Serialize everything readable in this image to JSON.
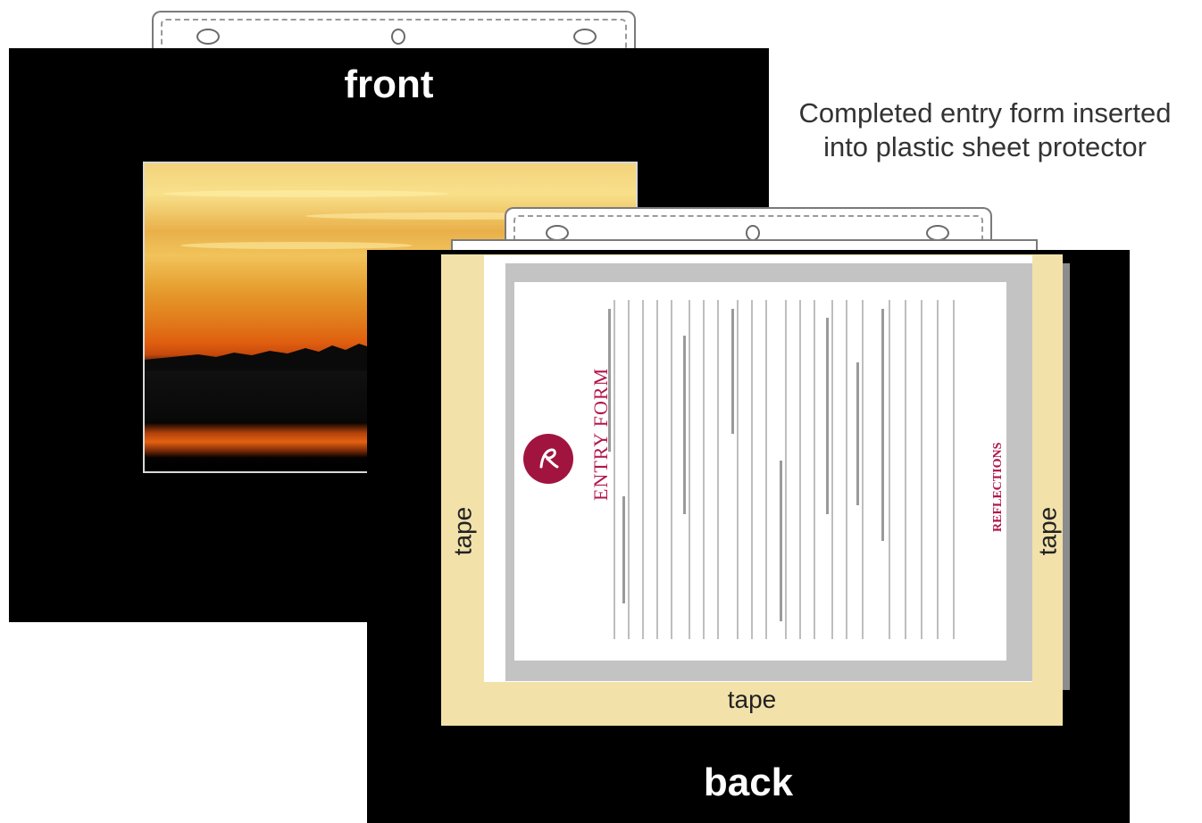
{
  "labels": {
    "front": "front",
    "back": "back",
    "caption_line1": "Completed entry form inserted",
    "caption_line2": "into plastic sheet protector",
    "tape_left": "tape",
    "tape_right": "tape",
    "tape_bottom": "tape"
  },
  "entry_form": {
    "title": "ENTRY FORM",
    "brand": "REFLECTIONS"
  },
  "colors": {
    "mat": "#000000",
    "tape": "#f2e2aa",
    "form_accent": "#b2154b",
    "protector": "#c3c3c3"
  }
}
